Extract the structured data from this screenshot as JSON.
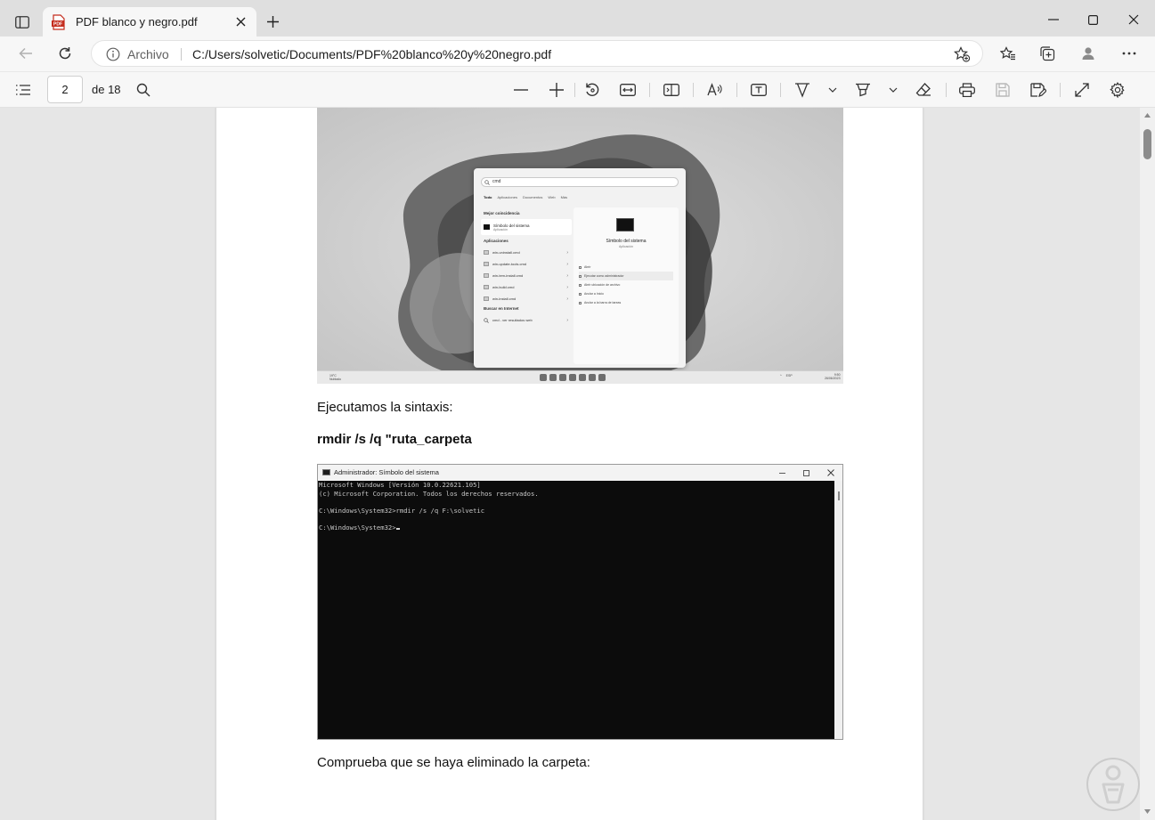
{
  "browser": {
    "tab_title": "PDF blanco y negro.pdf",
    "site_label": "Archivo",
    "url": "C:/Users/solvetic/Documents/PDF%20blanco%20y%20negro.pdf"
  },
  "pdf_toolbar": {
    "current_page": "2",
    "page_count": "de 18"
  },
  "embedded_screenshot": {
    "search_query": "cmd",
    "tabs": [
      "Todo",
      "Aplicaciones",
      "Documentos",
      "Web",
      "Más"
    ],
    "best_match_heading": "Mejor coincidencia",
    "best_match_title": "Símbolo del sistema",
    "best_match_subtitle": "Aplicación",
    "apps_heading": "Aplicaciones",
    "apps": [
      "win-uninstall.cmd",
      "win-update-tools.cmd",
      "win-tem-install.cmd",
      "win-build.cmd",
      "win-install.cmd"
    ],
    "web_heading": "Buscar en Internet",
    "web_item": "cmd - ver resultados web",
    "app_title": "Símbolo del sistema",
    "app_type": "Aplicación",
    "actions": [
      "Abrir",
      "Ejecutar como administrador",
      "Abrir ubicación de archivo",
      "Anclar a Inicio",
      "Anclar a la barra de tareas"
    ],
    "weather": [
      "19°C",
      "Nublado"
    ],
    "tray": [
      "ESP"
    ],
    "clock": [
      "9:50",
      "26/06/2023"
    ]
  },
  "document": {
    "para1": "Ejecutamos la sintaxis:",
    "command": "rmdir /s /q \"ruta_carpeta",
    "para2": "Comprueba que se haya eliminado la carpeta:"
  },
  "cmd_window": {
    "title": "Administrador: Símbolo del sistema",
    "lines": [
      "Microsoft Windows [Versión 10.0.22621.105]",
      "(c) Microsoft Corporation. Todos los derechos reservados.",
      "",
      "C:\\Windows\\System32>rmdir /s /q F:\\solvetic",
      "",
      "C:\\Windows\\System32>"
    ]
  }
}
